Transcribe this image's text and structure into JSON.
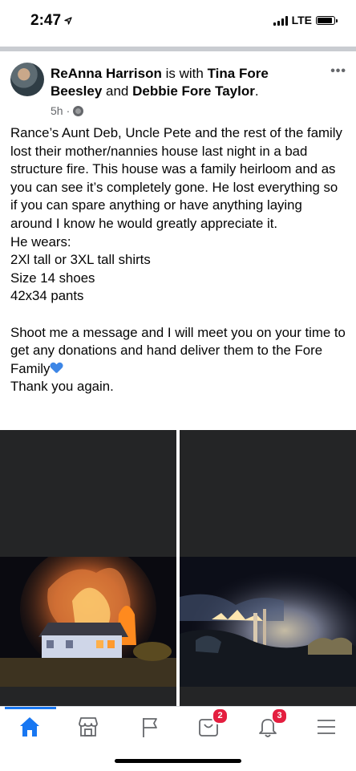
{
  "status_bar": {
    "time": "2:47",
    "network": "LTE"
  },
  "post": {
    "author": "ReAnna Harrison",
    "with_text": "is with",
    "tagged_1": "Tina Fore Beesley",
    "and_text": "and",
    "tagged_2": "Debbie Fore Taylor",
    "time_ago": "5h",
    "body": {
      "paragraph": "Rance’s Aunt Deb, Uncle Pete and the rest of the family lost their mother/nannies house last night in a bad structure fire. This house was a family heirloom and as you can see it’s completely gone. He lost everything so if you can spare anything or have anything laying around I know he would greatly appreciate it.",
      "wears_label": "He wears:",
      "line_shirts": "2Xl tall or 3XL tall shirts",
      "line_shoes": "Size 14 shoes",
      "line_pants": "42x34 pants",
      "closing": "Shoot me a message and I will meet you on your time to get any donations and hand deliver them to the Fore Family",
      "thanks": "Thank you again."
    }
  },
  "tab_bar": {
    "tabs": [
      {
        "icon": "home-icon",
        "active": true
      },
      {
        "icon": "marketplace-icon"
      },
      {
        "icon": "pages-flag-icon"
      },
      {
        "icon": "shop-icon",
        "badge": "2"
      },
      {
        "icon": "notifications-bell-icon",
        "badge": "3"
      },
      {
        "icon": "menu-icon"
      }
    ]
  },
  "colors": {
    "accent": "#1877f2",
    "badge": "#e41e3f",
    "meta_text": "#65676b",
    "heart_emoji": "#3d86e6"
  }
}
